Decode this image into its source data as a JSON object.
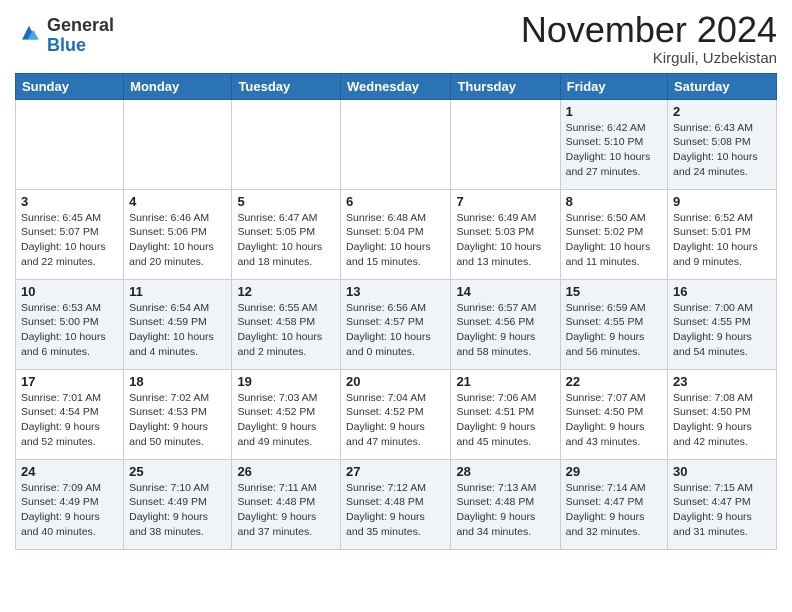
{
  "header": {
    "logo_line1": "General",
    "logo_line2": "Blue",
    "month_title": "November 2024",
    "location": "Kirguli, Uzbekistan"
  },
  "weekdays": [
    "Sunday",
    "Monday",
    "Tuesday",
    "Wednesday",
    "Thursday",
    "Friday",
    "Saturday"
  ],
  "weeks": [
    [
      {
        "day": "",
        "info": ""
      },
      {
        "day": "",
        "info": ""
      },
      {
        "day": "",
        "info": ""
      },
      {
        "day": "",
        "info": ""
      },
      {
        "day": "",
        "info": ""
      },
      {
        "day": "1",
        "info": "Sunrise: 6:42 AM\nSunset: 5:10 PM\nDaylight: 10 hours\nand 27 minutes."
      },
      {
        "day": "2",
        "info": "Sunrise: 6:43 AM\nSunset: 5:08 PM\nDaylight: 10 hours\nand 24 minutes."
      }
    ],
    [
      {
        "day": "3",
        "info": "Sunrise: 6:45 AM\nSunset: 5:07 PM\nDaylight: 10 hours\nand 22 minutes."
      },
      {
        "day": "4",
        "info": "Sunrise: 6:46 AM\nSunset: 5:06 PM\nDaylight: 10 hours\nand 20 minutes."
      },
      {
        "day": "5",
        "info": "Sunrise: 6:47 AM\nSunset: 5:05 PM\nDaylight: 10 hours\nand 18 minutes."
      },
      {
        "day": "6",
        "info": "Sunrise: 6:48 AM\nSunset: 5:04 PM\nDaylight: 10 hours\nand 15 minutes."
      },
      {
        "day": "7",
        "info": "Sunrise: 6:49 AM\nSunset: 5:03 PM\nDaylight: 10 hours\nand 13 minutes."
      },
      {
        "day": "8",
        "info": "Sunrise: 6:50 AM\nSunset: 5:02 PM\nDaylight: 10 hours\nand 11 minutes."
      },
      {
        "day": "9",
        "info": "Sunrise: 6:52 AM\nSunset: 5:01 PM\nDaylight: 10 hours\nand 9 minutes."
      }
    ],
    [
      {
        "day": "10",
        "info": "Sunrise: 6:53 AM\nSunset: 5:00 PM\nDaylight: 10 hours\nand 6 minutes."
      },
      {
        "day": "11",
        "info": "Sunrise: 6:54 AM\nSunset: 4:59 PM\nDaylight: 10 hours\nand 4 minutes."
      },
      {
        "day": "12",
        "info": "Sunrise: 6:55 AM\nSunset: 4:58 PM\nDaylight: 10 hours\nand 2 minutes."
      },
      {
        "day": "13",
        "info": "Sunrise: 6:56 AM\nSunset: 4:57 PM\nDaylight: 10 hours\nand 0 minutes."
      },
      {
        "day": "14",
        "info": "Sunrise: 6:57 AM\nSunset: 4:56 PM\nDaylight: 9 hours\nand 58 minutes."
      },
      {
        "day": "15",
        "info": "Sunrise: 6:59 AM\nSunset: 4:55 PM\nDaylight: 9 hours\nand 56 minutes."
      },
      {
        "day": "16",
        "info": "Sunrise: 7:00 AM\nSunset: 4:55 PM\nDaylight: 9 hours\nand 54 minutes."
      }
    ],
    [
      {
        "day": "17",
        "info": "Sunrise: 7:01 AM\nSunset: 4:54 PM\nDaylight: 9 hours\nand 52 minutes."
      },
      {
        "day": "18",
        "info": "Sunrise: 7:02 AM\nSunset: 4:53 PM\nDaylight: 9 hours\nand 50 minutes."
      },
      {
        "day": "19",
        "info": "Sunrise: 7:03 AM\nSunset: 4:52 PM\nDaylight: 9 hours\nand 49 minutes."
      },
      {
        "day": "20",
        "info": "Sunrise: 7:04 AM\nSunset: 4:52 PM\nDaylight: 9 hours\nand 47 minutes."
      },
      {
        "day": "21",
        "info": "Sunrise: 7:06 AM\nSunset: 4:51 PM\nDaylight: 9 hours\nand 45 minutes."
      },
      {
        "day": "22",
        "info": "Sunrise: 7:07 AM\nSunset: 4:50 PM\nDaylight: 9 hours\nand 43 minutes."
      },
      {
        "day": "23",
        "info": "Sunrise: 7:08 AM\nSunset: 4:50 PM\nDaylight: 9 hours\nand 42 minutes."
      }
    ],
    [
      {
        "day": "24",
        "info": "Sunrise: 7:09 AM\nSunset: 4:49 PM\nDaylight: 9 hours\nand 40 minutes."
      },
      {
        "day": "25",
        "info": "Sunrise: 7:10 AM\nSunset: 4:49 PM\nDaylight: 9 hours\nand 38 minutes."
      },
      {
        "day": "26",
        "info": "Sunrise: 7:11 AM\nSunset: 4:48 PM\nDaylight: 9 hours\nand 37 minutes."
      },
      {
        "day": "27",
        "info": "Sunrise: 7:12 AM\nSunset: 4:48 PM\nDaylight: 9 hours\nand 35 minutes."
      },
      {
        "day": "28",
        "info": "Sunrise: 7:13 AM\nSunset: 4:48 PM\nDaylight: 9 hours\nand 34 minutes."
      },
      {
        "day": "29",
        "info": "Sunrise: 7:14 AM\nSunset: 4:47 PM\nDaylight: 9 hours\nand 32 minutes."
      },
      {
        "day": "30",
        "info": "Sunrise: 7:15 AM\nSunset: 4:47 PM\nDaylight: 9 hours\nand 31 minutes."
      }
    ]
  ]
}
